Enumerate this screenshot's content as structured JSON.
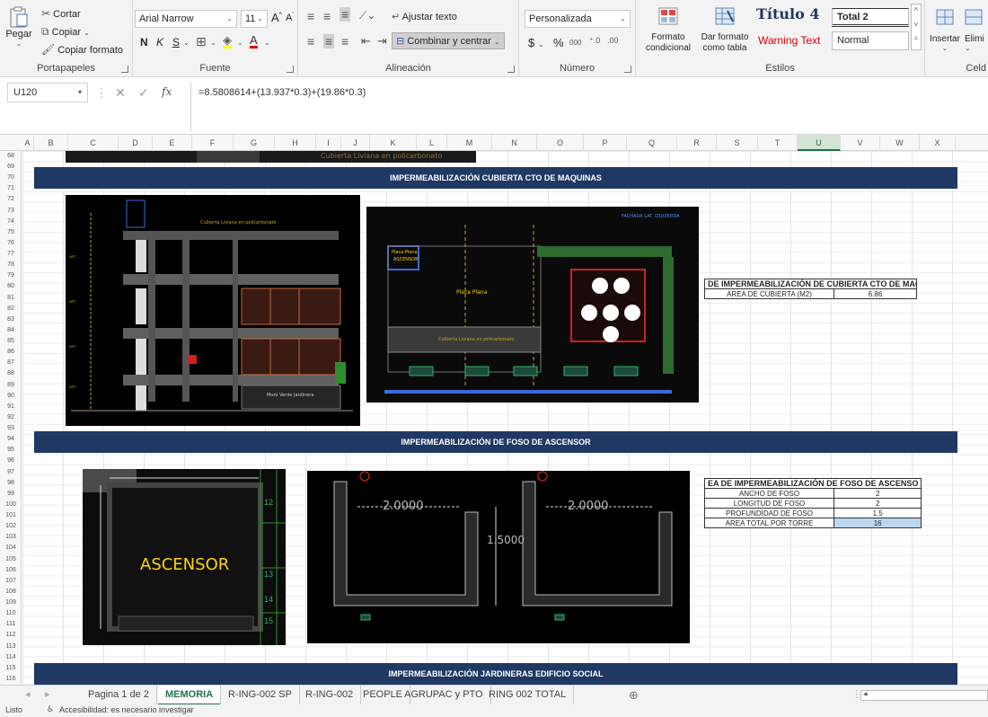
{
  "ribbon": {
    "clipboard": {
      "paste": "Pegar",
      "cut": "Cortar",
      "copy": "Copiar",
      "copy_format": "Copiar formato",
      "label": "Portapapeles"
    },
    "font": {
      "name": "Arial Narrow",
      "size": "11",
      "bold": "N",
      "italic": "K",
      "underline": "S",
      "label": "Fuente"
    },
    "alignment": {
      "wrap": "Ajustar texto",
      "merge": "Combinar y centrar",
      "label": "Alineación"
    },
    "number": {
      "format": "Personalizada",
      "currency": "$",
      "percent": "%",
      "thousands": "000",
      "label": "Número"
    },
    "styles": {
      "conditional": "Formato condicional",
      "as_table": "Dar formato como tabla",
      "titulo4": "Título 4",
      "total2": "Total 2",
      "warning": "Warning Text",
      "normal": "Normal",
      "label": "Estilos"
    },
    "cells": {
      "insert": "Insertar",
      "delete": "Elimi",
      "label": "Celd"
    }
  },
  "formula_bar": {
    "name_box": "U120",
    "formula": "=8.5808614+(13.937*0.3)+(19.86*0.3)"
  },
  "columns": [
    {
      "n": "A",
      "w": 14
    },
    {
      "n": "B",
      "w": 38
    },
    {
      "n": "C",
      "w": 56
    },
    {
      "n": "D",
      "w": 38
    },
    {
      "n": "E",
      "w": 44
    },
    {
      "n": "F",
      "w": 46
    },
    {
      "n": "G",
      "w": 46
    },
    {
      "n": "H",
      "w": 46
    },
    {
      "n": "I",
      "w": 28
    },
    {
      "n": "J",
      "w": 32
    },
    {
      "n": "K",
      "w": 52
    },
    {
      "n": "L",
      "w": 34
    },
    {
      "n": "M",
      "w": 50
    },
    {
      "n": "N",
      "w": 50
    },
    {
      "n": "O",
      "w": 52
    },
    {
      "n": "P",
      "w": 48
    },
    {
      "n": "Q",
      "w": 56
    },
    {
      "n": "R",
      "w": 44
    },
    {
      "n": "S",
      "w": 46
    },
    {
      "n": "T",
      "w": 44
    },
    {
      "n": "U",
      "w": 48
    },
    {
      "n": "V",
      "w": 44
    },
    {
      "n": "W",
      "w": 44
    },
    {
      "n": "X",
      "w": 40
    }
  ],
  "rows": [
    "68",
    "69",
    "70",
    "71",
    "72",
    "73",
    "74",
    "75",
    "76",
    "77",
    "78",
    "79",
    "80",
    "81",
    "82",
    "83",
    "84",
    "85",
    "86",
    "87",
    "88",
    "89",
    "90",
    "91",
    "92",
    "93",
    "94",
    "95",
    "96",
    "97",
    "98",
    "99",
    "100",
    "101",
    "102",
    "103",
    "104",
    "105",
    "106",
    "107",
    "108",
    "109",
    "110",
    "111",
    "112",
    "113",
    "114",
    "115",
    "116"
  ],
  "sheet": {
    "banner1": "IMPERMEABILIZACIÓN CUBIERTA CTO DE MAQUINAS",
    "banner2": "IMPERMEABILIZACIÓN DE FOSO DE ASCENSOR",
    "banner3": "IMPERMEABILIZACIÓN JARDINERAS EDIFICIO SOCIAL",
    "partial_top": "Cubierta Liviana en policarbonato",
    "table1": {
      "title": "DE IMPERMEABILIZACIÓN DE CUBIERTA CTO DE MAQ",
      "rows": [
        {
          "label": "AREA DE CUBIERTA (M2)",
          "value": "6.86"
        }
      ]
    },
    "table2": {
      "title": "EA DE IMPERMEABILIZACIÓN DE FOSO DE ASCENSO",
      "rows": [
        {
          "label": "ANCHO DE FOSO",
          "value": "2"
        },
        {
          "label": "LONGITUD DE FOSO",
          "value": "2"
        },
        {
          "label": "PROFUNDIDAD DE FOSO",
          "value": "1.5"
        },
        {
          "label": "AREA TOTAL POR TORRE",
          "value": "16"
        }
      ]
    },
    "plan": {
      "placa1": "Placa Plana",
      "ascensor_small": "ASCENSOR",
      "placa2": "Placa Plana",
      "cubierta": "Cubierta Liviana en policarbonato",
      "fachada": "FACHADA LAT. IZQUIERDA"
    },
    "elevation": {
      "cubierta": "Cubierta Liviana en policarbonato",
      "muro": "Muro Verde Jardinera"
    },
    "foso": {
      "ascensor": "ASCENSOR"
    },
    "section": {
      "dim1": "2.0000",
      "dim2": "2.0000",
      "dim3": "1.5000"
    }
  },
  "tabs": [
    "Pagina 1 de 2",
    "MEMORIA",
    "R-ING-002 SP",
    "R-ING-002",
    "PEOPLE",
    "AGRUPAC y PTO",
    "RING 002 TOTAL"
  ],
  "status": {
    "ready": "Listo",
    "accessibility": "Accesibilidad: es necesario investigar"
  },
  "colors": {
    "banner": "#1f3864",
    "excel_green": "#217346",
    "cad_bg": "#000000",
    "highlight": "#bdd7ee"
  }
}
